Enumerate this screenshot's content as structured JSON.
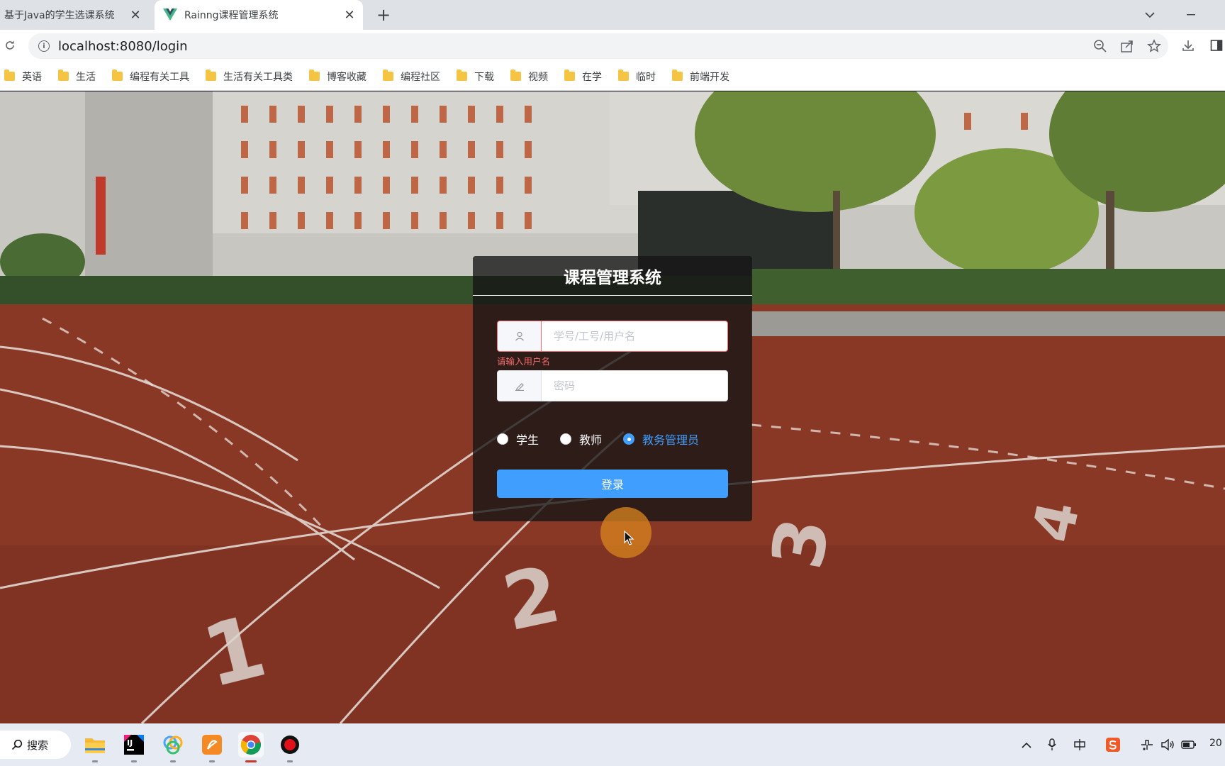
{
  "browser": {
    "tabs": [
      {
        "title": "基于Java的学生选课系统",
        "active": false
      },
      {
        "title": "Rainng课程管理系统",
        "active": true
      }
    ],
    "address": "localhost:8080/login",
    "bookmarks": [
      "英语",
      "生活",
      "编程有关工具",
      "生活有关工具类",
      "博客收藏",
      "编程社区",
      "下载",
      "视频",
      "在学",
      "临时",
      "前端开发"
    ]
  },
  "login": {
    "title": "课程管理系统",
    "username_placeholder": "学号/工号/用户名",
    "username_value": "",
    "username_error": "请输入用户名",
    "password_placeholder": "密码",
    "password_value": "",
    "roles": [
      {
        "label": "学生",
        "checked": false
      },
      {
        "label": "教师",
        "checked": false
      },
      {
        "label": "教务管理员",
        "checked": true
      }
    ],
    "submit_label": "登录"
  },
  "track_lane_numbers": [
    "1",
    "2",
    "3",
    "4"
  ],
  "taskbar": {
    "search_label": "搜索",
    "apps": [
      "file-explorer-icon",
      "intellij-idea-icon",
      "color-app-icon",
      "pdf-app-icon",
      "chrome-icon",
      "recorder-icon"
    ],
    "tray": [
      "chevron-up-icon",
      "microphone-icon",
      "input-method-icon",
      "sogou-icon",
      "network-icon",
      "volume-icon",
      "battery-icon"
    ],
    "clock_fragment": "20"
  },
  "colors": {
    "primary": "#409eff",
    "error": "#f56c6c",
    "panel": "rgba(20,20,20,0.78)",
    "track": "#8f3b28"
  }
}
